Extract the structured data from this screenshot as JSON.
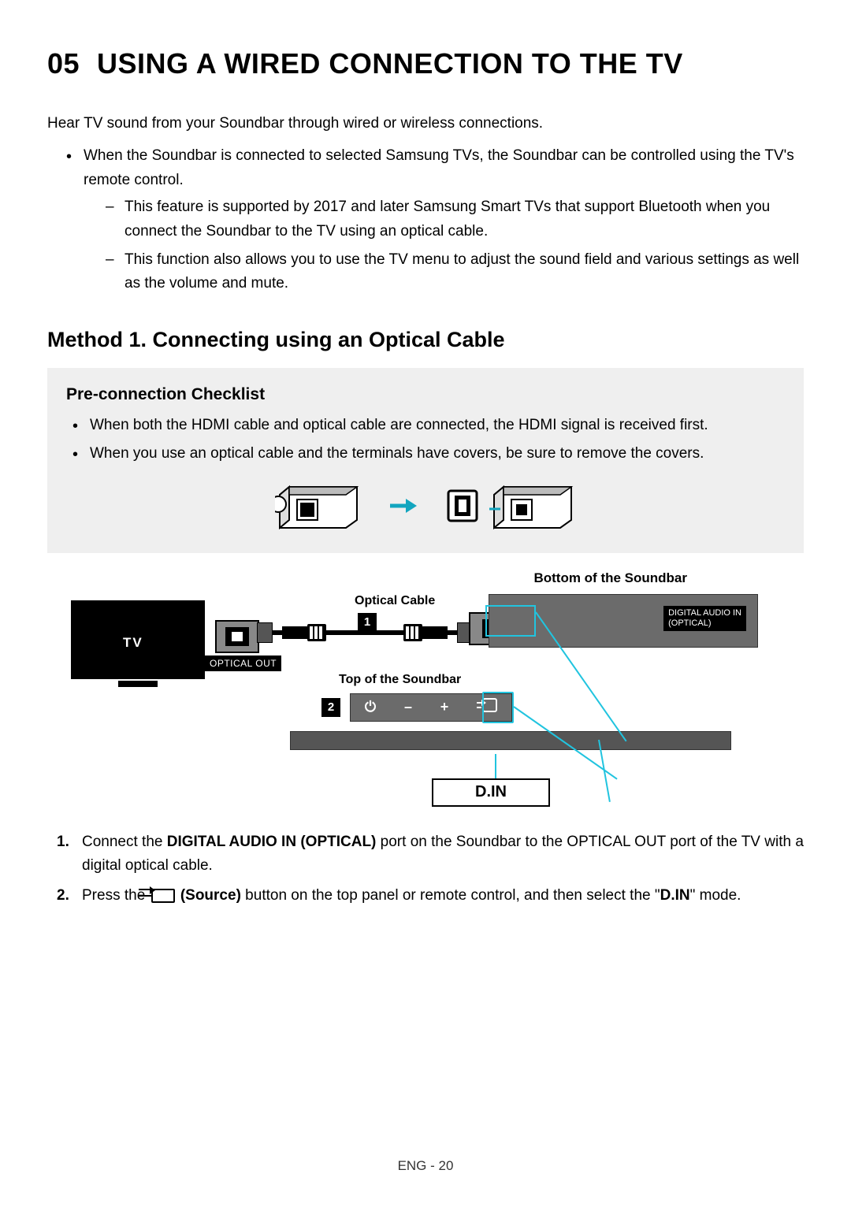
{
  "section": {
    "number": "05",
    "title": "USING A WIRED CONNECTION TO THE TV"
  },
  "intro": "Hear TV sound from your Soundbar through wired or wireless connections.",
  "bullets": [
    "When the Soundbar is connected to selected Samsung TVs, the Soundbar can be controlled using the TV's remote control."
  ],
  "subdashes": [
    "This feature is supported by 2017 and later Samsung Smart TVs that support Bluetooth when you connect the Soundbar to the TV using an optical cable.",
    "This function also allows you to use the TV menu to adjust the sound field and various settings as well as the volume and mute."
  ],
  "method_heading": "Method 1. Connecting using an Optical Cable",
  "checklist": {
    "title": "Pre-connection Checklist",
    "items": [
      "When both the HDMI cable and optical cable are connected, the HDMI signal is received first.",
      "When you use an optical cable and the terminals have covers, be sure to remove the covers."
    ]
  },
  "diagram": {
    "bottom_label": "Bottom of the Soundbar",
    "optical_cable_label": "Optical Cable",
    "tv_label": "TV",
    "optical_out": "OPTICAL OUT",
    "top_label": "Top of the Soundbar",
    "din_port_label_line1": "DIGITAL AUDIO IN",
    "din_port_label_line2": "(OPTICAL)",
    "step1": "1",
    "step2": "2",
    "panel": {
      "power": "⏻",
      "minus": "–",
      "plus": "+"
    },
    "din_display": "D.IN"
  },
  "steps": {
    "s1_num": "1.",
    "s1_a": "Connect the ",
    "s1_b": "DIGITAL AUDIO IN (OPTICAL)",
    "s1_c": " port on the Soundbar to the OPTICAL OUT port of the TV with a digital optical cable.",
    "s2_num": "2.",
    "s2_a": "Press the ",
    "s2_b": "(Source)",
    "s2_c": " button on the top panel or remote control, and then select the \"",
    "s2_d": "D.IN",
    "s2_e": "\" mode."
  },
  "footer": "ENG - 20"
}
